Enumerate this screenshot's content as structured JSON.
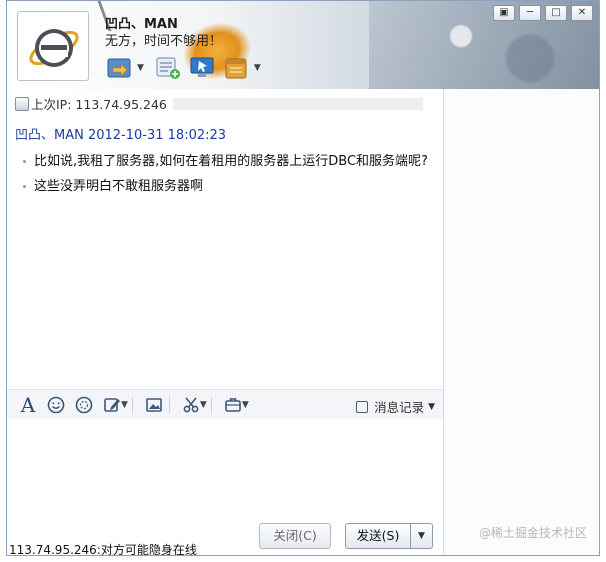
{
  "contact": {
    "name": "凹凸、MAN",
    "status_message": "无方，时间不够用！"
  },
  "window_controls": [
    "▣",
    "─",
    "□",
    "✕"
  ],
  "toolbar_top": {
    "icons": [
      "transfer-file-icon",
      "add-note-icon",
      "remote-assist-icon",
      "app-box-icon"
    ]
  },
  "chat": {
    "last_ip_label": "上次IP: 113.74.95.246",
    "sender_line": "凹凸、MAN 2012-10-31 18:02:23",
    "messages": [
      "比如说,我租了服务器,如何在着租用的服务器上运行DBC和服务端呢?",
      "这些没弄明白不敢租服务器啊"
    ]
  },
  "edit_toolbar": {
    "font_glyph": "A",
    "history_label": "消息记录"
  },
  "bottom": {
    "status_text": "113.74.95.246:对方可能隐身在线",
    "close_label": "关闭(C)",
    "send_label": "发送(S)"
  },
  "watermark": "@稀土掘金技术社区",
  "colors": {
    "sender": "#1a3aa6",
    "accent_border": "#8aa2bf"
  }
}
